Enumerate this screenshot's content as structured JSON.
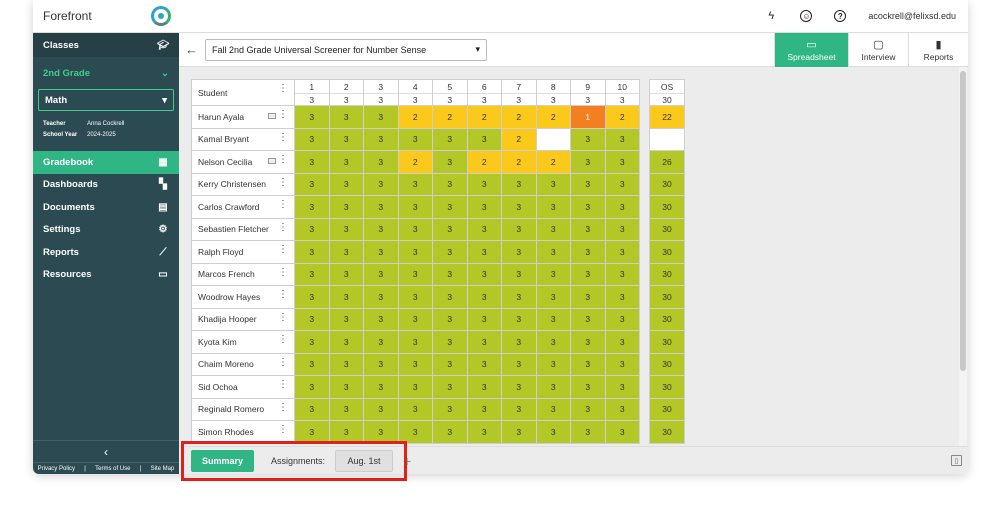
{
  "app": {
    "name": "Forefront"
  },
  "topbar": {
    "user_email": "acockrell@felixsd.edu"
  },
  "sidebar": {
    "classes_label": "Classes",
    "grade_label": "2nd Grade",
    "subject_label": "Math",
    "teacher_key": "Teacher",
    "teacher_value": "Anna Cockrell",
    "year_key": "School Year",
    "year_value": "2024-2025",
    "nav": [
      {
        "label": "Gradebook",
        "icon": "grid-icon",
        "active": true
      },
      {
        "label": "Dashboards",
        "icon": "dashboard-icon",
        "active": false
      },
      {
        "label": "Documents",
        "icon": "document-icon",
        "active": false
      },
      {
        "label": "Settings",
        "icon": "gear-icon",
        "active": false
      },
      {
        "label": "Reports",
        "icon": "trend-icon",
        "active": false
      },
      {
        "label": "Resources",
        "icon": "folder-icon",
        "active": false
      }
    ],
    "footer": [
      "Privacy Policy",
      "Terms of Use",
      "Site Map"
    ]
  },
  "toolbar": {
    "assessment": "Fall 2nd Grade Universal Screener for Number Sense",
    "views": [
      {
        "label": "Spreadsheet",
        "active": true
      },
      {
        "label": "Interview",
        "active": false
      },
      {
        "label": "Reports",
        "active": false
      }
    ]
  },
  "grid": {
    "student_header": "Student",
    "columns": [
      "1",
      "2",
      "3",
      "4",
      "5",
      "6",
      "7",
      "8",
      "9",
      "10"
    ],
    "max_points": [
      "3",
      "3",
      "3",
      "3",
      "3",
      "3",
      "3",
      "3",
      "3",
      "3"
    ],
    "os_header": "OS",
    "os_max": "30",
    "rows": [
      {
        "name": "Harun Ayala",
        "note": true,
        "scores": [
          "3",
          "3",
          "3",
          "2",
          "2",
          "2",
          "2",
          "2",
          "1",
          "2"
        ],
        "os": "22"
      },
      {
        "name": "Kamal Bryant",
        "note": false,
        "scores": [
          "3",
          "3",
          "3",
          "3",
          "3",
          "3",
          "2",
          "",
          "3",
          "3"
        ],
        "os": ""
      },
      {
        "name": "Nelson Cecilia",
        "note": true,
        "scores": [
          "3",
          "3",
          "3",
          "2",
          "3",
          "2",
          "2",
          "2",
          "3",
          "3"
        ],
        "os": "26"
      },
      {
        "name": "Kerry Christensen",
        "note": false,
        "scores": [
          "3",
          "3",
          "3",
          "3",
          "3",
          "3",
          "3",
          "3",
          "3",
          "3"
        ],
        "os": "30"
      },
      {
        "name": "Carlos Crawford",
        "note": false,
        "scores": [
          "3",
          "3",
          "3",
          "3",
          "3",
          "3",
          "3",
          "3",
          "3",
          "3"
        ],
        "os": "30"
      },
      {
        "name": "Sebastien Fletcher",
        "note": false,
        "scores": [
          "3",
          "3",
          "3",
          "3",
          "3",
          "3",
          "3",
          "3",
          "3",
          "3"
        ],
        "os": "30"
      },
      {
        "name": "Ralph Floyd",
        "note": false,
        "scores": [
          "3",
          "3",
          "3",
          "3",
          "3",
          "3",
          "3",
          "3",
          "3",
          "3"
        ],
        "os": "30"
      },
      {
        "name": "Marcos French",
        "note": false,
        "scores": [
          "3",
          "3",
          "3",
          "3",
          "3",
          "3",
          "3",
          "3",
          "3",
          "3"
        ],
        "os": "30"
      },
      {
        "name": "Woodrow Hayes",
        "note": false,
        "scores": [
          "3",
          "3",
          "3",
          "3",
          "3",
          "3",
          "3",
          "3",
          "3",
          "3"
        ],
        "os": "30"
      },
      {
        "name": "Khadija Hooper",
        "note": false,
        "scores": [
          "3",
          "3",
          "3",
          "3",
          "3",
          "3",
          "3",
          "3",
          "3",
          "3"
        ],
        "os": "30"
      },
      {
        "name": "Kyota Kim",
        "note": false,
        "scores": [
          "3",
          "3",
          "3",
          "3",
          "3",
          "3",
          "3",
          "3",
          "3",
          "3"
        ],
        "os": "30"
      },
      {
        "name": "Chaim Moreno",
        "note": false,
        "scores": [
          "3",
          "3",
          "3",
          "3",
          "3",
          "3",
          "3",
          "3",
          "3",
          "3"
        ],
        "os": "30"
      },
      {
        "name": "Sid Ochoa",
        "note": false,
        "scores": [
          "3",
          "3",
          "3",
          "3",
          "3",
          "3",
          "3",
          "3",
          "3",
          "3"
        ],
        "os": "30"
      },
      {
        "name": "Reginald Romero",
        "note": false,
        "scores": [
          "3",
          "3",
          "3",
          "3",
          "3",
          "3",
          "3",
          "3",
          "3",
          "3"
        ],
        "os": "30"
      },
      {
        "name": "Simon Rhodes",
        "note": false,
        "scores": [
          "3",
          "3",
          "3",
          "3",
          "3",
          "3",
          "3",
          "3",
          "3",
          "3"
        ],
        "os": "30"
      }
    ]
  },
  "bottombar": {
    "summary_label": "Summary",
    "assignments_label": "Assignments:",
    "assignment_date": "Aug. 1st",
    "add_symbol": "+"
  },
  "colors": {
    "accent": "#2fb684",
    "sidebar": "#2c4a52",
    "score3": "#b3c827",
    "score2": "#fbc91b",
    "score1": "#f47f20",
    "highlight": "#e0211b"
  }
}
